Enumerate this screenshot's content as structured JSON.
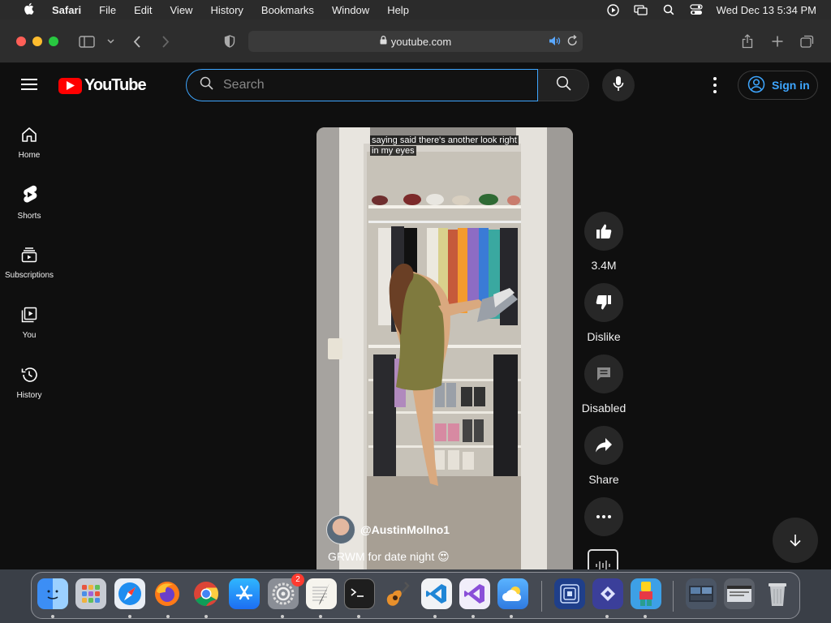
{
  "menubar": {
    "app": "Safari",
    "items": [
      "File",
      "Edit",
      "View",
      "History",
      "Bookmarks",
      "Window",
      "Help"
    ],
    "clock": "Wed Dec 13  5:34 PM"
  },
  "browser": {
    "url": "youtube.com"
  },
  "youtube": {
    "logo_text": "YouTube",
    "search_placeholder": "Search",
    "sign_in": "Sign in",
    "nav": [
      {
        "label": "Home",
        "icon": "home-icon"
      },
      {
        "label": "Shorts",
        "icon": "shorts-icon"
      },
      {
        "label": "Subscriptions",
        "icon": "subscriptions-icon"
      },
      {
        "label": "You",
        "icon": "you-icon"
      },
      {
        "label": "History",
        "icon": "history-icon"
      }
    ],
    "short": {
      "caption_line1": "saying said there's another look right",
      "caption_line2": "in my eyes",
      "channel": "@AustinMollno1",
      "title": "GRWM for date night 😍"
    },
    "actions": {
      "like": "3.4M",
      "dislike": "Dislike",
      "comments": "Disabled",
      "share": "Share"
    }
  },
  "dock": {
    "settings_badge": "2"
  },
  "colors": {
    "yt_red": "#ff0000",
    "link_blue": "#3ea6ff",
    "bg": "#0f0f0f"
  }
}
